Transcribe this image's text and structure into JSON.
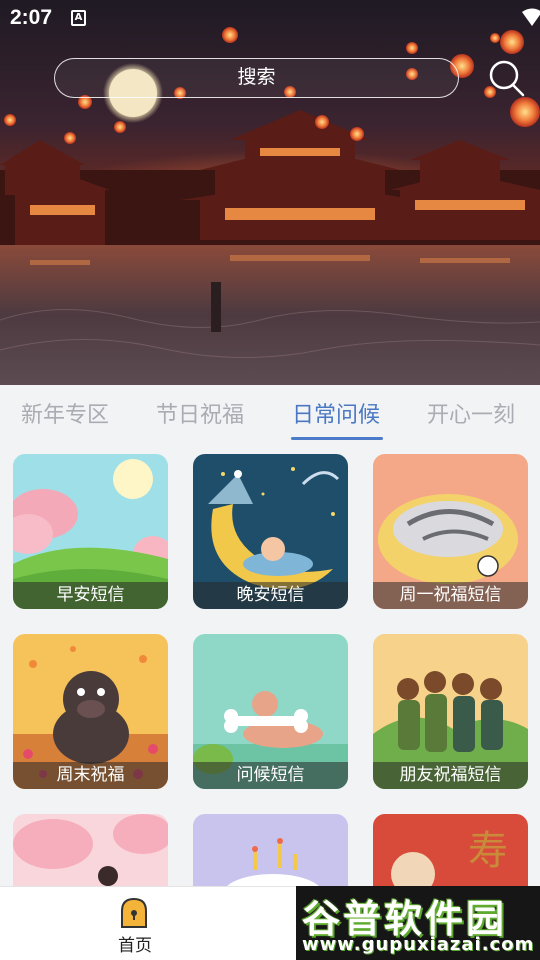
{
  "status_bar": {
    "time": "2:07",
    "notification_glyph": "A"
  },
  "search": {
    "placeholder": "搜索"
  },
  "tabs": [
    {
      "label": "新年专区"
    },
    {
      "label": "节日祝福"
    },
    {
      "label": "日常问候",
      "active": true
    },
    {
      "label": "开心一刻"
    }
  ],
  "cards": [
    {
      "label": "早安短信"
    },
    {
      "label": "晚安短信"
    },
    {
      "label": "周一祝福短信"
    },
    {
      "label": "周末祝福"
    },
    {
      "label": "问候短信"
    },
    {
      "label": "朋友祝福短信"
    },
    {
      "label": ""
    },
    {
      "label": ""
    },
    {
      "label": ""
    }
  ],
  "bottom_nav": {
    "home_label": "首页",
    "home_icon": "home-ghost-icon"
  },
  "watermark": {
    "title": "谷普软件园",
    "url": "www.gupuxiazai.com"
  },
  "colors": {
    "accent": "#4b7bc9",
    "tab_inactive": "#a9acb2",
    "background": "#f2f3f5"
  }
}
